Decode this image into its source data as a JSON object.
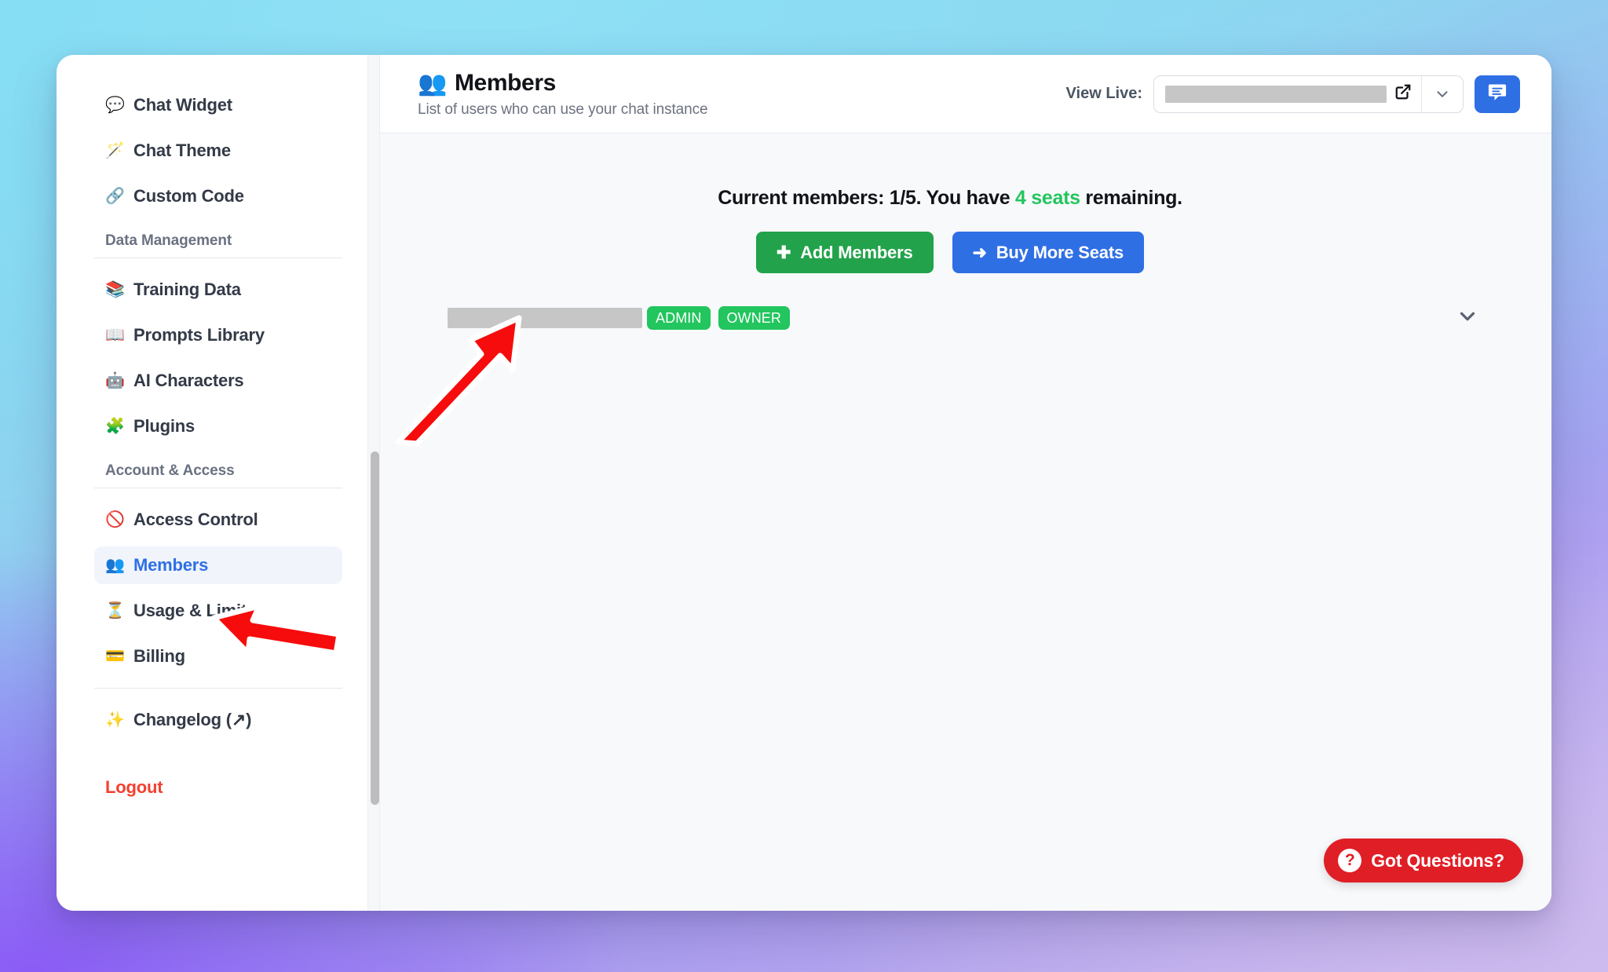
{
  "sidebar": {
    "items_top": [
      {
        "icon": "💬",
        "icon_name": "speech-balloon-icon",
        "label": "Chat Widget"
      },
      {
        "icon": "🪄",
        "icon_name": "magic-wand-icon",
        "label": "Chat Theme"
      },
      {
        "icon": "🔗",
        "icon_name": "link-icon",
        "label": "Custom Code"
      }
    ],
    "section_data": "Data Management",
    "items_data": [
      {
        "icon": "📚",
        "icon_name": "books-icon",
        "label": "Training Data"
      },
      {
        "icon": "📖",
        "icon_name": "open-book-icon",
        "label": "Prompts Library"
      },
      {
        "icon": "🤖",
        "icon_name": "robot-icon",
        "label": "AI Characters"
      },
      {
        "icon": "🧩",
        "icon_name": "puzzle-piece-icon",
        "label": "Plugins"
      }
    ],
    "section_account": "Account & Access",
    "items_account": [
      {
        "icon": "🚫",
        "icon_name": "prohibited-icon",
        "label": "Access Control",
        "active": false
      },
      {
        "icon": "👥",
        "icon_name": "busts-in-silhouette-icon",
        "label": "Members",
        "active": true
      },
      {
        "icon": "⏳",
        "icon_name": "hourglass-icon",
        "label": "Usage & Limits",
        "active": false
      },
      {
        "icon": "💳",
        "icon_name": "credit-card-icon",
        "label": "Billing",
        "active": false
      }
    ],
    "items_footer": [
      {
        "icon": "✨",
        "icon_name": "sparkles-icon",
        "label": "Changelog (↗)"
      }
    ],
    "logout_label": "Logout"
  },
  "header": {
    "title_icon": "👥",
    "title": "Members",
    "subtitle": "List of users who can use your chat instance",
    "view_live_label": "View Live:",
    "url_value": "",
    "caret_glyph": "⌄",
    "chat_button_label": ""
  },
  "main": {
    "seat_prefix": "Current members: 1/5. You have ",
    "seat_highlight": "4 seats",
    "seat_suffix": " remaining.",
    "add_members_label": "Add Members",
    "add_members_icon": "✚",
    "buy_seats_label": "Buy More Seats",
    "buy_seats_icon": "➜",
    "member": {
      "email": "",
      "badges": [
        "ADMIN",
        "OWNER"
      ],
      "caret_glyph": "⌄"
    },
    "got_questions_label": "Got Questions?",
    "got_questions_icon": "?"
  },
  "counts": {
    "current_members": 1,
    "max_members": 5,
    "seats_remaining": 4
  },
  "colors": {
    "accent_blue": "#2f6fe4",
    "green": "#22a24b",
    "badge_green": "#22c55e",
    "danger_red": "#f3402f",
    "help_red": "#e01e26",
    "annotation_red": "#f60c0c"
  }
}
